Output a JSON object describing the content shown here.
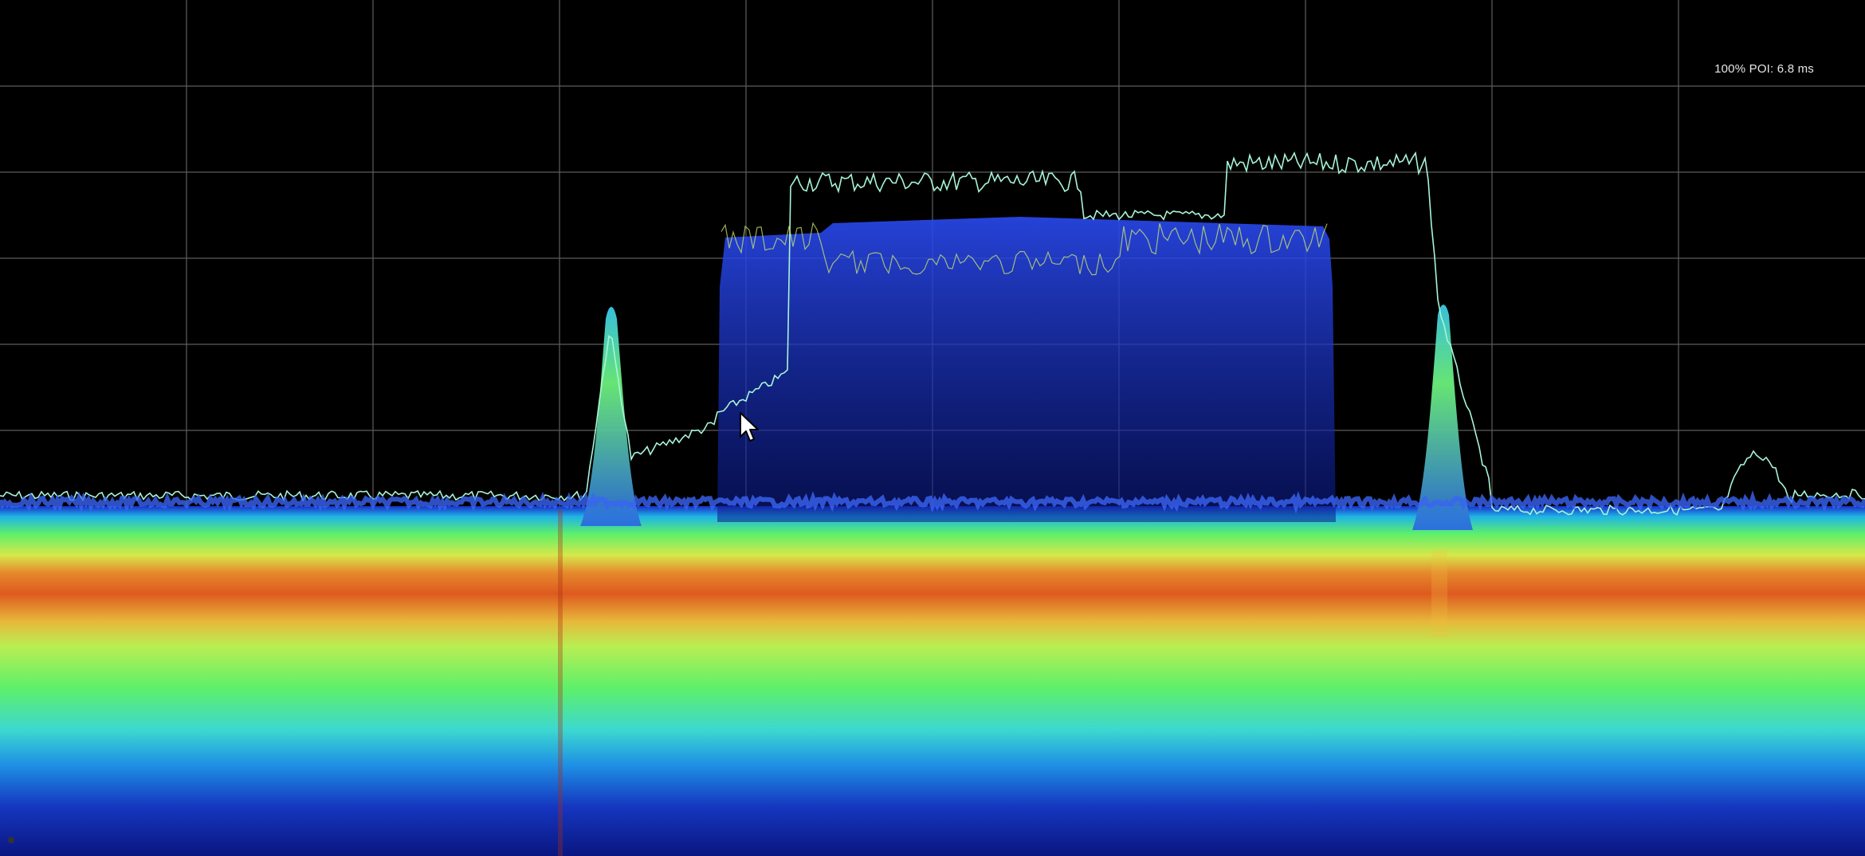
{
  "overlay": {
    "poi_text": "100% POI: 6.8 ms"
  },
  "display": {
    "graticule": {
      "columns": 10,
      "rows": 6
    },
    "colors": {
      "background": "#000000",
      "grid": "#6e6e6e",
      "trace": "#a8f5d6",
      "density_low": "#0a1fb0",
      "density_mid": "#42e070",
      "density_high": "#e0541f"
    }
  },
  "icons": [
    "mouse-pointer-icon"
  ]
}
